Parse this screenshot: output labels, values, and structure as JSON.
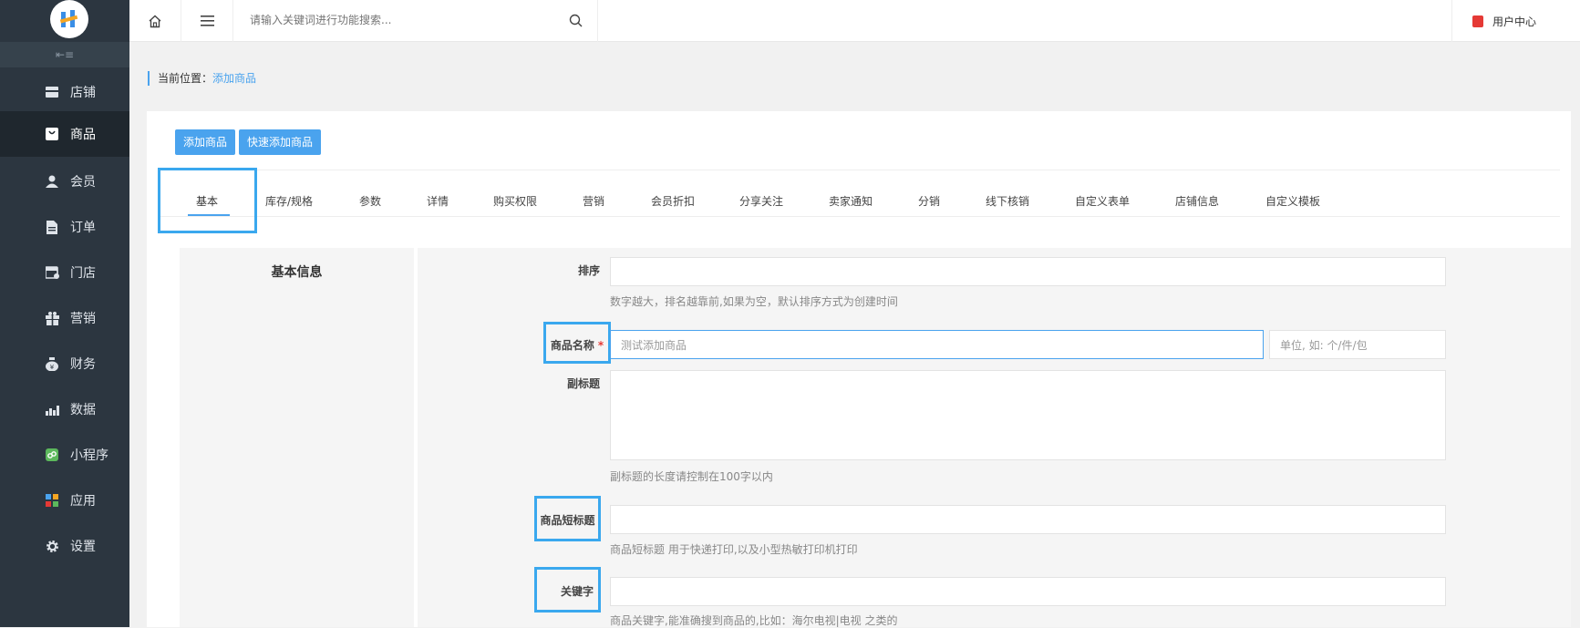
{
  "app": {
    "title": "用户中心"
  },
  "sidebar": {
    "collapse_icon": "collapse-icon",
    "items": [
      {
        "label": "店铺",
        "icon": "store-icon"
      },
      {
        "label": "商品",
        "icon": "goods-icon"
      },
      {
        "label": "会员",
        "icon": "member-icon"
      },
      {
        "label": "订单",
        "icon": "order-icon"
      },
      {
        "label": "门店",
        "icon": "shop-icon"
      },
      {
        "label": "营销",
        "icon": "gift-icon"
      },
      {
        "label": "财务",
        "icon": "money-bag-icon"
      },
      {
        "label": "数据",
        "icon": "chart-icon"
      },
      {
        "label": "小程序",
        "icon": "miniprogram-icon"
      },
      {
        "label": "应用",
        "icon": "apps-icon"
      },
      {
        "label": "设置",
        "icon": "gear-icon"
      }
    ],
    "active_index": 1
  },
  "topbar": {
    "search_placeholder": "请输入关键词进行功能搜索...",
    "user_center_label": "用户中心"
  },
  "breadcrumb": {
    "prefix": "当前位置：",
    "current": "添加商品"
  },
  "actions": {
    "add_goods": "添加商品",
    "quick_add_goods": "快速添加商品"
  },
  "tabs": [
    "基本",
    "库存/规格",
    "参数",
    "详情",
    "购买权限",
    "营销",
    "会员折扣",
    "分享关注",
    "卖家通知",
    "分销",
    "线下核销",
    "自定义表单",
    "店铺信息",
    "自定义模板"
  ],
  "section": {
    "title": "基本信息"
  },
  "form": {
    "sort": {
      "label": "排序",
      "value": "",
      "hint": "数字越大，排名越靠前,如果为空，默认排序方式为创建时间"
    },
    "name": {
      "label": "商品名称",
      "required": "*",
      "value": "测试添加商品",
      "unit_placeholder": "单位, 如: 个/件/包"
    },
    "subtitle": {
      "label": "副标题",
      "value": "",
      "hint": "副标题的长度请控制在100字以内"
    },
    "short_title": {
      "label": "商品短标题",
      "value": "",
      "hint": "商品短标题 用于快递打印,以及小型热敏打印机打印"
    },
    "keywords": {
      "label": "关键字",
      "value": "",
      "hint": "商品关键字,能准确搜到商品的,比如：海尔电视|电视 之类的"
    }
  },
  "colors": {
    "accent": "#4aa3ee",
    "sidebar_bg": "#2c3640",
    "highlight": "#3aa8ee",
    "required": "#e53935"
  }
}
